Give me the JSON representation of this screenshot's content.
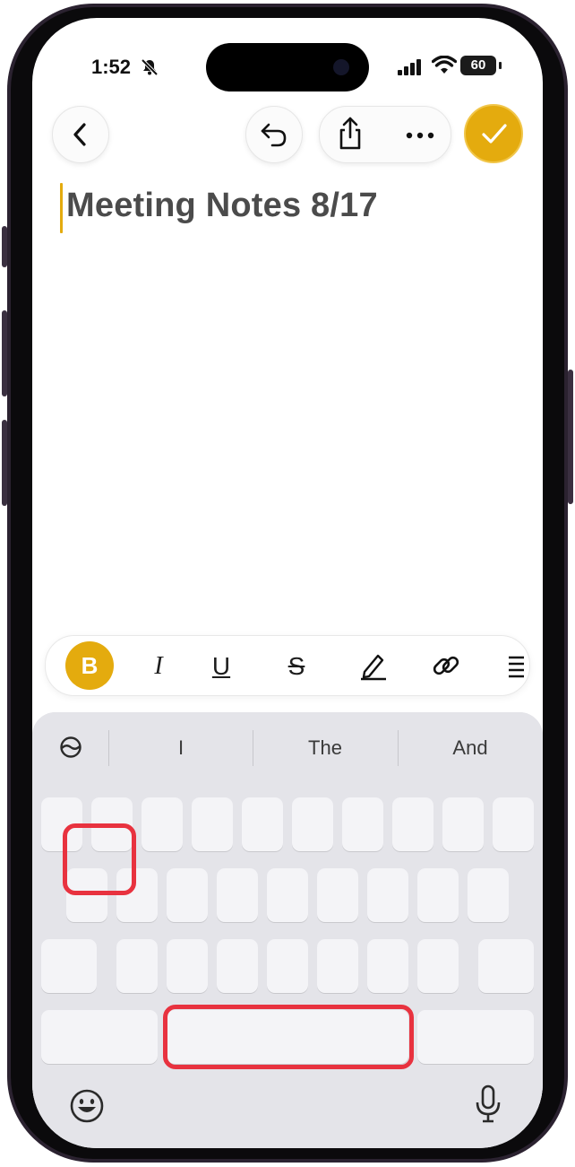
{
  "status_bar": {
    "time": "1:52",
    "battery": "60",
    "bell_icon": "bell-slash-icon",
    "signal_icon": "cellular-signal-icon",
    "wifi_icon": "wifi-icon"
  },
  "toolbar": {
    "back_icon": "chevron-left-icon",
    "undo_icon": "undo-icon",
    "share_icon": "share-icon",
    "more_icon": "ellipsis-icon",
    "done_icon": "checkmark-icon",
    "accent_color": "#e4ab0e"
  },
  "note": {
    "title": "Meeting Notes 8/17"
  },
  "format_bar": {
    "bold_label": "B",
    "italic_label": "I",
    "underline_label": "U",
    "strike_label": "S",
    "highlight_icon": "pencil-icon",
    "link_icon": "link-icon",
    "list_icon": "list-icon"
  },
  "keyboard": {
    "suggestions": [
      "I",
      "The",
      "And"
    ],
    "predictive_icon": "predictive-toggle-icon",
    "emoji_icon": "emoji-icon",
    "mic_icon": "microphone-icon",
    "highlight_color": "#e8323f"
  }
}
